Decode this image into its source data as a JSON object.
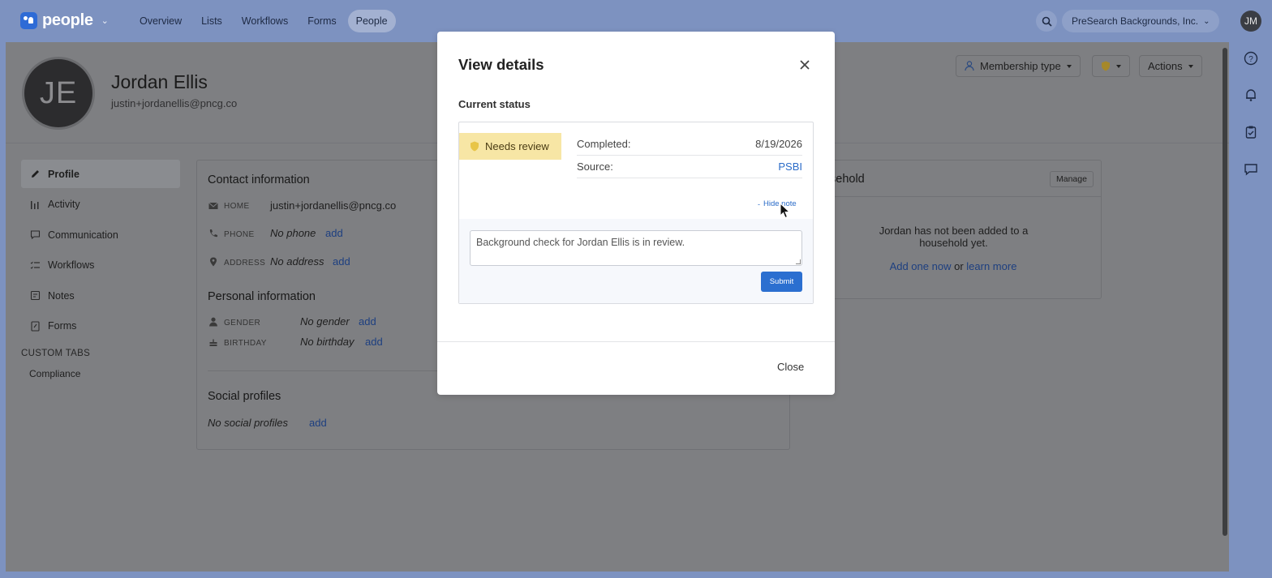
{
  "topbar": {
    "app_name": "people",
    "nav": [
      "Overview",
      "Lists",
      "Workflows",
      "Forms",
      "People"
    ],
    "active_nav": "People",
    "org_name": "PreSearch Backgrounds, Inc.",
    "user_initials": "JM"
  },
  "person": {
    "initials": "JE",
    "name": "Jordan Ellis",
    "email": "justin+jordanellis@pncg.co"
  },
  "header_actions": {
    "membership_type": "Membership type",
    "actions": "Actions"
  },
  "sidebar": {
    "items": [
      {
        "label": "Profile",
        "icon": "pencil-icon"
      },
      {
        "label": "Activity",
        "icon": "bar-chart-icon"
      },
      {
        "label": "Communication",
        "icon": "chat-icon"
      },
      {
        "label": "Workflows",
        "icon": "checklist-icon"
      },
      {
        "label": "Notes",
        "icon": "note-icon"
      },
      {
        "label": "Forms",
        "icon": "form-icon"
      }
    ],
    "custom_tabs_title": "CUSTOM TABS",
    "custom_tabs": [
      "Compliance"
    ]
  },
  "contact": {
    "title": "Contact information",
    "home_label": "HOME",
    "home_value": "justin+jordanellis@pncg.co",
    "phone_label": "PHONE",
    "phone_value": "No phone",
    "address_label": "ADDRESS",
    "address_value": "No address",
    "add_label": "add"
  },
  "personal": {
    "title": "Personal information",
    "gender_label": "GENDER",
    "gender_value": "No gender",
    "birthday_label": "BIRTHDAY",
    "birthday_value": "No birthday"
  },
  "social": {
    "title": "Social profiles",
    "value": "No social profiles"
  },
  "household": {
    "title_partial": "sehold",
    "manage_label": "Manage",
    "empty_text": "Jordan has not been added to a household yet.",
    "add_link": "Add one now",
    "or_text": "or",
    "learn_link": "learn more"
  },
  "modal": {
    "title": "View details",
    "section_label": "Current status",
    "status": "Needs review",
    "completed_label": "Completed:",
    "completed_value": "8/19/2026",
    "source_label": "Source:",
    "source_value": "PSBI",
    "hide_note": "Hide note",
    "note_text": "Background check for Jordan Ellis is in review.",
    "submit_label": "Submit",
    "close_label": "Close"
  },
  "colors": {
    "accent": "#2b6fd0",
    "status_badge_bg": "#f7e6a5",
    "topbar_bg": "#7d92c0"
  }
}
